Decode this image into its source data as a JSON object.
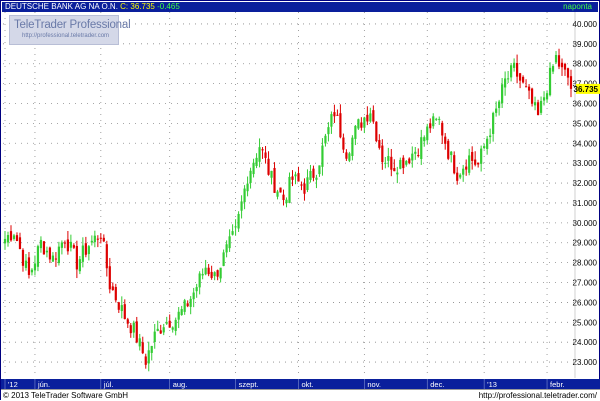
{
  "header": {
    "title": "DEUTSCHE BANK AG NA O.N.",
    "close_text": "C: 36.735",
    "change_text": "-0.465",
    "period": "naponta"
  },
  "watermark": {
    "title": "TeleTrader Professional",
    "url": "http://professional.teletrader.com"
  },
  "footer": {
    "copyright": "© 2013 TeleTrader Software GmbH",
    "url": "http://professional.teletrader.com/"
  },
  "colors": {
    "up": "#33cc33",
    "down": "#dd0000",
    "title_bar": "#0a1f9c",
    "axis_bar": "#0a1f9c",
    "last_price_bg": "#ffff00"
  },
  "chart_data": {
    "type": "candlestick",
    "title": "DEUTSCHE BANK AG NA O.N.",
    "ylim": [
      22.2,
      40.6
    ],
    "y_ticks": [
      23,
      24,
      25,
      26,
      27,
      28,
      29,
      30,
      31,
      32,
      33,
      34,
      35,
      36,
      37,
      38,
      39,
      40
    ],
    "y_tick_labels": [
      "23.000",
      "24.000",
      "25.000",
      "26.000",
      "27.000",
      "28.000",
      "29.000",
      "30.000",
      "31.000",
      "32.000",
      "33.000",
      "34.000",
      "35.000",
      "36.000",
      "37.000",
      "38.000",
      "39.000",
      "40.000"
    ],
    "x_labels": [
      "'12",
      "jún.",
      "júl.",
      "aug.",
      "szept.",
      "okt.",
      "nov.",
      "dec.",
      "'13",
      "febr."
    ],
    "x_label_index": [
      0,
      10,
      32,
      55,
      77,
      98,
      120,
      141,
      160,
      181
    ],
    "last_price": 36.735,
    "last_price_label": "36.735",
    "grid": true,
    "key_points": [
      {
        "i": 0,
        "close": 29.2
      },
      {
        "i": 3,
        "close": 29.6
      },
      {
        "i": 8,
        "close": 27.3
      },
      {
        "i": 12,
        "close": 29.0
      },
      {
        "i": 16,
        "close": 28.2
      },
      {
        "i": 20,
        "close": 29.3
      },
      {
        "i": 24,
        "close": 28.0
      },
      {
        "i": 28,
        "close": 28.9
      },
      {
        "i": 32,
        "close": 29.5
      },
      {
        "i": 35,
        "close": 26.9
      },
      {
        "i": 40,
        "close": 25.3
      },
      {
        "i": 43,
        "close": 24.6
      },
      {
        "i": 47,
        "close": 23.1
      },
      {
        "i": 50,
        "close": 24.3
      },
      {
        "i": 53,
        "close": 25.0
      },
      {
        "i": 57,
        "close": 25.2
      },
      {
        "i": 60,
        "close": 25.7
      },
      {
        "i": 63,
        "close": 26.5
      },
      {
        "i": 67,
        "close": 27.8
      },
      {
        "i": 70,
        "close": 27.3
      },
      {
        "i": 74,
        "close": 28.6
      },
      {
        "i": 77,
        "close": 29.5
      },
      {
        "i": 81,
        "close": 32.4
      },
      {
        "i": 85,
        "close": 33.9
      },
      {
        "i": 89,
        "close": 32.2
      },
      {
        "i": 93,
        "close": 31.2
      },
      {
        "i": 96,
        "close": 32.2
      },
      {
        "i": 100,
        "close": 31.8
      },
      {
        "i": 104,
        "close": 32.7
      },
      {
        "i": 107,
        "close": 34.2
      },
      {
        "i": 110,
        "close": 35.6
      },
      {
        "i": 114,
        "close": 33.6
      },
      {
        "i": 118,
        "close": 34.9
      },
      {
        "i": 122,
        "close": 35.7
      },
      {
        "i": 126,
        "close": 33.3
      },
      {
        "i": 130,
        "close": 32.9
      },
      {
        "i": 134,
        "close": 33.2
      },
      {
        "i": 138,
        "close": 33.8
      },
      {
        "i": 142,
        "close": 34.9
      },
      {
        "i": 145,
        "close": 35.1
      },
      {
        "i": 148,
        "close": 33.6
      },
      {
        "i": 151,
        "close": 32.5
      },
      {
        "i": 155,
        "close": 33.3
      },
      {
        "i": 158,
        "close": 32.9
      },
      {
        "i": 161,
        "close": 34.3
      },
      {
        "i": 164,
        "close": 35.6
      },
      {
        "i": 167,
        "close": 37.1
      },
      {
        "i": 170,
        "close": 37.7
      },
      {
        "i": 174,
        "close": 36.6
      },
      {
        "i": 178,
        "close": 35.3
      },
      {
        "i": 181,
        "close": 36.9
      },
      {
        "i": 184,
        "close": 38.3
      },
      {
        "i": 186,
        "close": 37.6
      },
      {
        "i": 188,
        "close": 37.3
      },
      {
        "i": 189,
        "close": 36.735
      }
    ]
  }
}
